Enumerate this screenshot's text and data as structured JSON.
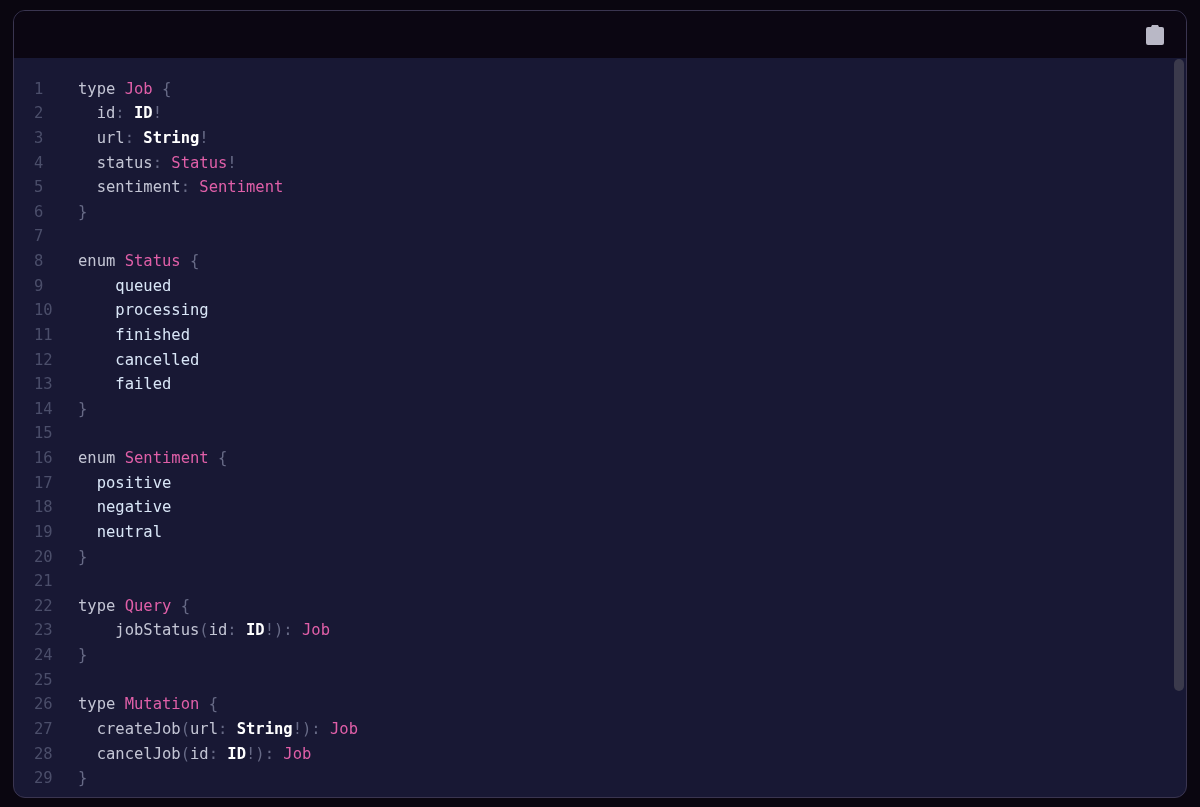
{
  "code_block": {
    "lines": [
      {
        "number": "1",
        "tokens": [
          {
            "text": "type ",
            "kind": "keyword"
          },
          {
            "text": "Job",
            "kind": "name"
          },
          {
            "text": " {",
            "kind": "punct"
          }
        ]
      },
      {
        "number": "2",
        "tokens": [
          {
            "text": "  id",
            "kind": "field"
          },
          {
            "text": ": ",
            "kind": "punct"
          },
          {
            "text": "ID",
            "kind": "builtin"
          },
          {
            "text": "!",
            "kind": "punct"
          }
        ]
      },
      {
        "number": "3",
        "tokens": [
          {
            "text": "  url",
            "kind": "field"
          },
          {
            "text": ": ",
            "kind": "punct"
          },
          {
            "text": "String",
            "kind": "builtin"
          },
          {
            "text": "!",
            "kind": "punct"
          }
        ]
      },
      {
        "number": "4",
        "tokens": [
          {
            "text": "  status",
            "kind": "field"
          },
          {
            "text": ": ",
            "kind": "punct"
          },
          {
            "text": "Status",
            "kind": "name"
          },
          {
            "text": "!",
            "kind": "punct"
          }
        ]
      },
      {
        "number": "5",
        "tokens": [
          {
            "text": "  sentiment",
            "kind": "field"
          },
          {
            "text": ": ",
            "kind": "punct"
          },
          {
            "text": "Sentiment",
            "kind": "name"
          }
        ]
      },
      {
        "number": "6",
        "tokens": [
          {
            "text": "}",
            "kind": "punct"
          }
        ]
      },
      {
        "number": "7"
      },
      {
        "number": "8",
        "tokens": [
          {
            "text": "enum ",
            "kind": "keyword"
          },
          {
            "text": "Status",
            "kind": "name"
          },
          {
            "text": " {",
            "kind": "punct"
          }
        ]
      },
      {
        "number": "9",
        "tokens": [
          {
            "text": "    queued",
            "kind": "value"
          }
        ]
      },
      {
        "number": "10",
        "tokens": [
          {
            "text": "    processing",
            "kind": "value"
          }
        ]
      },
      {
        "number": "11",
        "tokens": [
          {
            "text": "    finished",
            "kind": "value"
          }
        ]
      },
      {
        "number": "12",
        "tokens": [
          {
            "text": "    cancelled",
            "kind": "value"
          }
        ]
      },
      {
        "number": "13",
        "tokens": [
          {
            "text": "    failed",
            "kind": "value"
          }
        ]
      },
      {
        "number": "14",
        "tokens": [
          {
            "text": "}",
            "kind": "punct"
          }
        ]
      },
      {
        "number": "15"
      },
      {
        "number": "16",
        "tokens": [
          {
            "text": "enum ",
            "kind": "keyword"
          },
          {
            "text": "Sentiment",
            "kind": "name"
          },
          {
            "text": " {",
            "kind": "punct"
          }
        ]
      },
      {
        "number": "17",
        "tokens": [
          {
            "text": "  positive",
            "kind": "value"
          }
        ]
      },
      {
        "number": "18",
        "tokens": [
          {
            "text": "  negative",
            "kind": "value"
          }
        ]
      },
      {
        "number": "19",
        "tokens": [
          {
            "text": "  neutral",
            "kind": "value"
          }
        ]
      },
      {
        "number": "20",
        "tokens": [
          {
            "text": "}",
            "kind": "punct"
          }
        ]
      },
      {
        "number": "21"
      },
      {
        "number": "22",
        "tokens": [
          {
            "text": "type ",
            "kind": "keyword"
          },
          {
            "text": "Query",
            "kind": "name"
          },
          {
            "text": " {",
            "kind": "punct"
          }
        ]
      },
      {
        "number": "23",
        "tokens": [
          {
            "text": "    jobStatus",
            "kind": "field"
          },
          {
            "text": "(",
            "kind": "punct"
          },
          {
            "text": "id",
            "kind": "field"
          },
          {
            "text": ": ",
            "kind": "punct"
          },
          {
            "text": "ID",
            "kind": "builtin"
          },
          {
            "text": "!): ",
            "kind": "punct"
          },
          {
            "text": "Job",
            "kind": "name"
          }
        ]
      },
      {
        "number": "24",
        "tokens": [
          {
            "text": "}",
            "kind": "punct"
          }
        ]
      },
      {
        "number": "25"
      },
      {
        "number": "26",
        "tokens": [
          {
            "text": "type ",
            "kind": "keyword"
          },
          {
            "text": "Mutation",
            "kind": "name"
          },
          {
            "text": " {",
            "kind": "punct"
          }
        ]
      },
      {
        "number": "27",
        "tokens": [
          {
            "text": "  createJob",
            "kind": "field"
          },
          {
            "text": "(",
            "kind": "punct"
          },
          {
            "text": "url",
            "kind": "field"
          },
          {
            "text": ": ",
            "kind": "punct"
          },
          {
            "text": "String",
            "kind": "builtin"
          },
          {
            "text": "!): ",
            "kind": "punct"
          },
          {
            "text": "Job",
            "kind": "name"
          }
        ]
      },
      {
        "number": "28",
        "tokens": [
          {
            "text": "  cancelJob",
            "kind": "field"
          },
          {
            "text": "(",
            "kind": "punct"
          },
          {
            "text": "id",
            "kind": "field"
          },
          {
            "text": ": ",
            "kind": "punct"
          },
          {
            "text": "ID",
            "kind": "builtin"
          },
          {
            "text": "!): ",
            "kind": "punct"
          },
          {
            "text": "Job",
            "kind": "name"
          }
        ]
      },
      {
        "number": "29",
        "tokens": [
          {
            "text": "}",
            "kind": "punct"
          }
        ]
      }
    ]
  }
}
